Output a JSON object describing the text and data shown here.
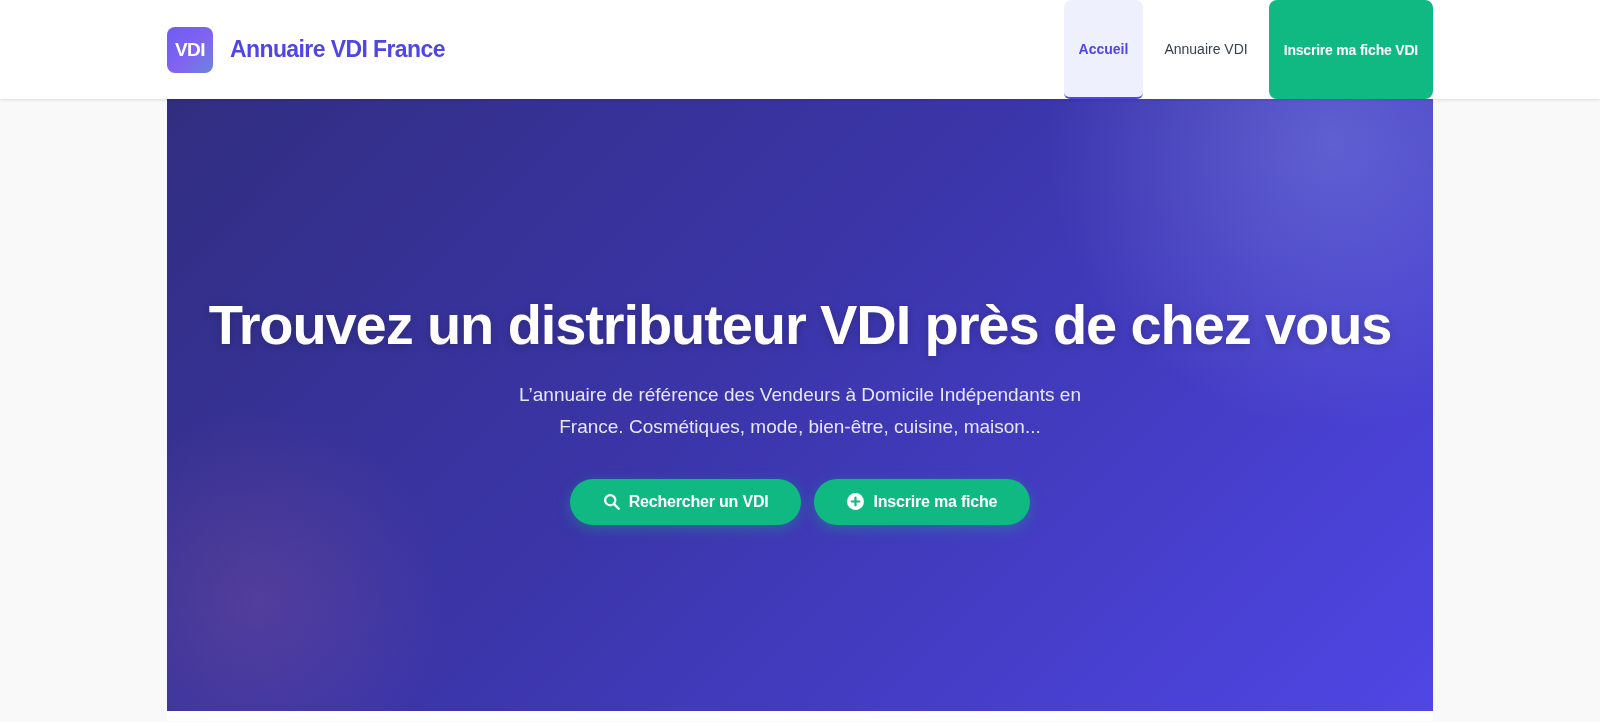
{
  "header": {
    "logo": {
      "badge": "VDI",
      "title": "Annuaire VDI France"
    },
    "nav": [
      {
        "label": "Accueil",
        "kind": "link",
        "selected": true
      },
      {
        "label": "Annuaire VDI",
        "kind": "link",
        "selected": false
      },
      {
        "label": "Inscrire ma fiche VDI",
        "kind": "cta",
        "selected": false
      }
    ]
  },
  "hero": {
    "title": "Trouvez un distributeur VDI près de chez vous",
    "subtitle": "L’annuaire de référence des Vendeurs à Domicile Indépendants en France. Cosmétiques, mode, bien-être, cuisine, maison...",
    "buttons": [
      {
        "label": "Rechercher un VDI",
        "kind": "search"
      },
      {
        "label": "Inscrire ma fiche",
        "kind": "add"
      }
    ]
  }
}
